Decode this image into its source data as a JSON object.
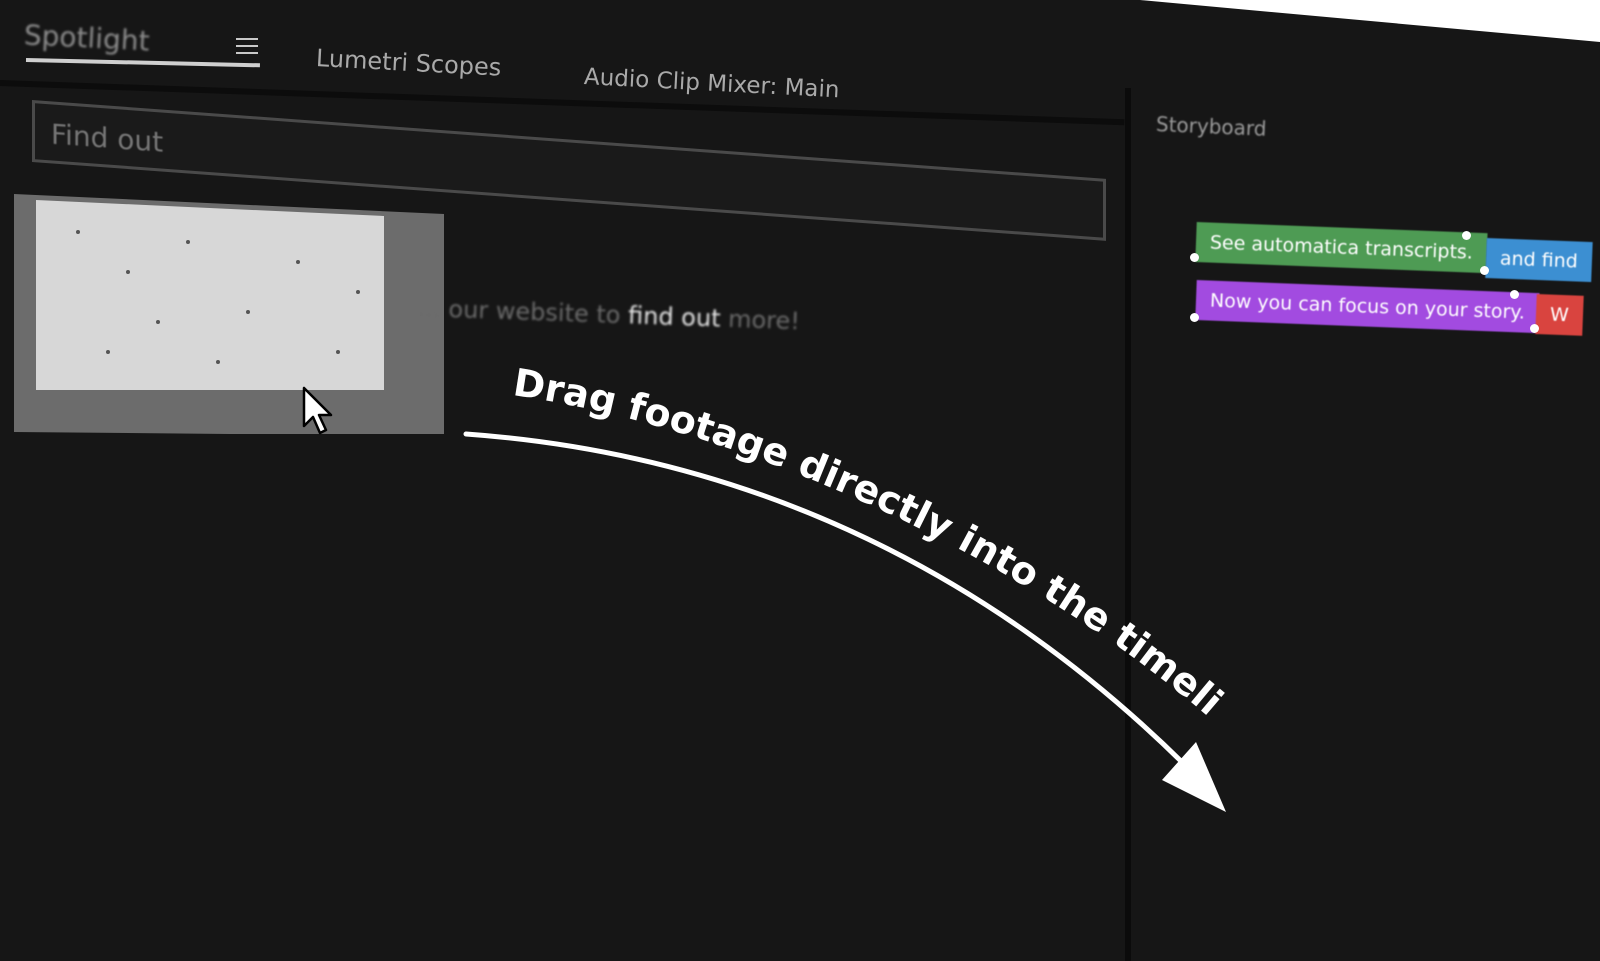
{
  "tabs": {
    "spotlight": "Spotlight",
    "lumetri": "Lumetri Scopes",
    "audio": "Audio Clip Mixer: Main"
  },
  "icons": {
    "menu": "hamburger-menu-icon",
    "cursor": "mouse-pointer-icon",
    "arrow": "curved-arrow"
  },
  "search": {
    "placeholder": "Find out"
  },
  "result": {
    "prefix": "... our website to ",
    "highlight": "find out",
    "suffix": " more!"
  },
  "storyboard": {
    "title": "Storyboard",
    "chips": [
      {
        "label": "See automatica transcripts.",
        "color": "#4e9b54"
      },
      {
        "label": "and find",
        "color": "#3c8fd2"
      },
      {
        "label": "Now you can focus on your story.",
        "color": "#a24be0"
      },
      {
        "label": "W",
        "color": "#d9443f"
      }
    ]
  },
  "annotation": {
    "text": "Drag footage directly into the timeline"
  }
}
